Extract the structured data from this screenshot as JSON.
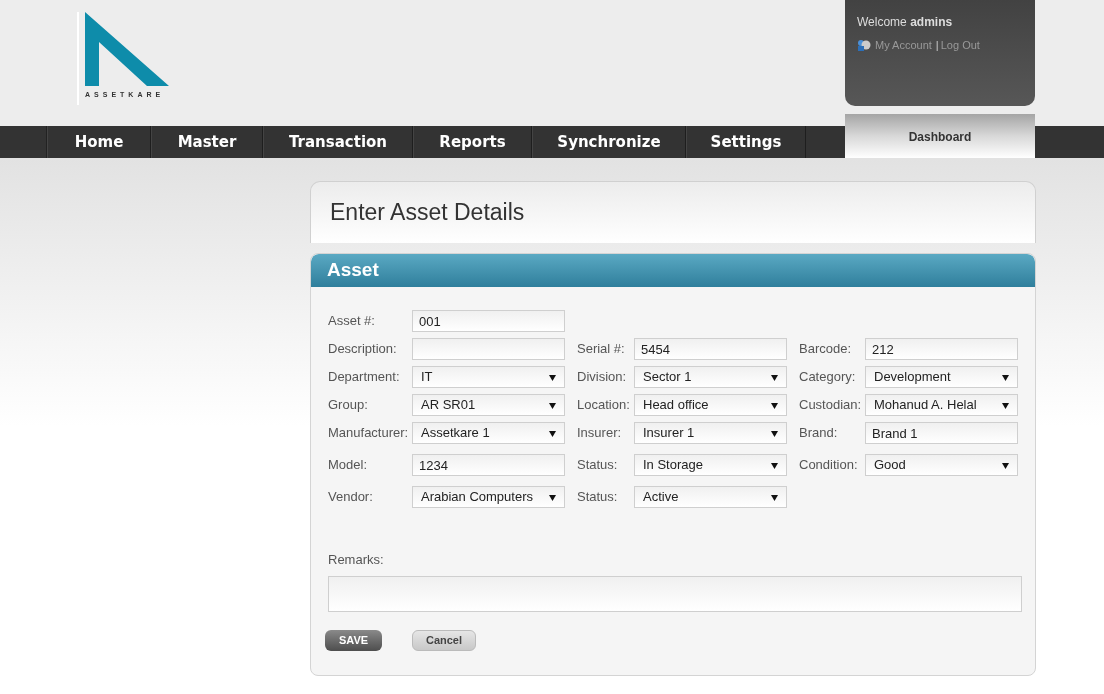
{
  "logo": {
    "text": "ASSETKARE"
  },
  "user_panel": {
    "greeting": "Welcome",
    "user": "admins",
    "links": [
      {
        "label": "My Account"
      },
      {
        "label": "Log Out"
      }
    ],
    "separator": "|"
  },
  "nav": {
    "items": [
      {
        "label": "Home"
      },
      {
        "label": "Master"
      },
      {
        "label": "Transaction"
      },
      {
        "label": "Reports"
      },
      {
        "label": "Synchronize"
      },
      {
        "label": "Settings"
      }
    ],
    "tab": {
      "label": "Dashboard",
      "selected": true
    }
  },
  "page_title": "Enter Asset Details",
  "section": {
    "title": "Asset",
    "rows": [
      [
        {
          "label": "Asset #:",
          "kind": "text",
          "value": "001"
        }
      ],
      [
        {
          "label": "Description:",
          "kind": "text"
        },
        {
          "label": "Serial #:",
          "kind": "text",
          "value": "5454"
        },
        {
          "label": "Barcode:",
          "kind": "text",
          "value": "212"
        }
      ],
      [
        {
          "label": "Department:",
          "kind": "select",
          "value": "IT"
        },
        {
          "label": "Division:",
          "kind": "select",
          "value": "Sector 1"
        },
        {
          "label": "Category:",
          "kind": "select",
          "value": "Development"
        }
      ],
      [
        {
          "label": "Group:",
          "kind": "select",
          "value": "AR SR01"
        },
        {
          "label": "Location:",
          "kind": "select",
          "value": "Head office"
        },
        {
          "label": "Custodian:",
          "kind": "select",
          "value": "Mohanud A. Helal"
        }
      ],
      [
        {
          "label": "Manufacturer:",
          "kind": "select",
          "value": "Assetkare 1"
        },
        {
          "label": "Insurer:",
          "kind": "select",
          "value": "Insurer 1"
        },
        {
          "label": "Brand:",
          "kind": "text",
          "value": "Brand 1"
        }
      ],
      [
        {
          "label": "Model:",
          "kind": "text",
          "value": "1234"
        },
        {
          "label": "Status:",
          "kind": "select",
          "value": "In Storage"
        },
        {
          "label": "Condition:",
          "kind": "select",
          "value": "Good"
        }
      ],
      [
        {
          "label": "Vendor:",
          "kind": "select",
          "value": "Arabian Computers"
        },
        {
          "label": "Status:",
          "kind": "select",
          "value": "Active"
        }
      ]
    ],
    "remarks": {
      "label": "Remarks:"
    },
    "buttons": [
      {
        "label": "SAVE",
        "kind": "primary"
      },
      {
        "label": "Cancel",
        "kind": "secondary"
      }
    ]
  }
}
